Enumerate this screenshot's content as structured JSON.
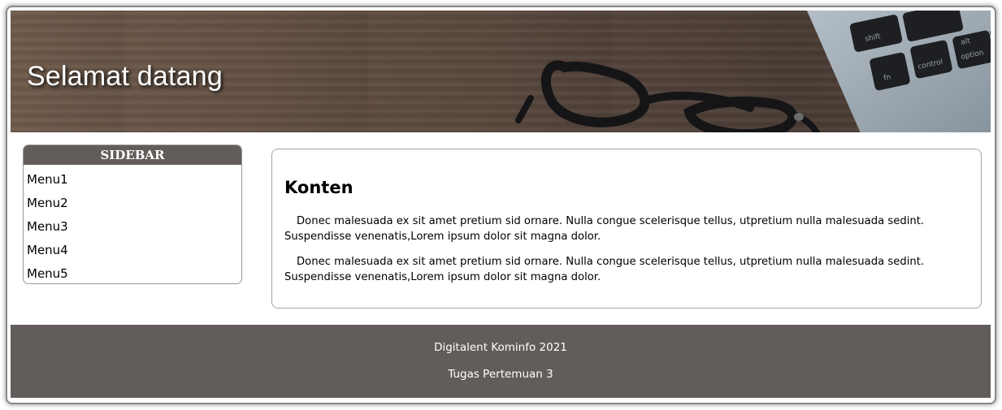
{
  "header": {
    "title": "Selamat datang"
  },
  "sidebar": {
    "title": "SIDEBAR",
    "items": [
      {
        "label": "Menu1"
      },
      {
        "label": "Menu2"
      },
      {
        "label": "Menu3"
      },
      {
        "label": "Menu4"
      },
      {
        "label": "Menu5"
      }
    ]
  },
  "content": {
    "heading": "Konten",
    "paragraphs": [
      "Donec malesuada ex sit amet pretium sid ornare. Nulla congue scelerisque tellus, utpretium nulla malesuada sedint. Suspendisse venenatis,Lorem ipsum dolor sit magna dolor.",
      "Donec malesuada ex sit amet pretium sid ornare. Nulla congue scelerisque tellus, utpretium nulla malesuada sedint. Suspendisse venenatis,Lorem ipsum dolor sit magna dolor."
    ]
  },
  "footer": {
    "line1": "Digitalent Kominfo 2021",
    "line2": "Tugas Pertemuan 3"
  },
  "colors": {
    "bar": "#625d5b",
    "header_wood": "#5f4c3f",
    "border": "#9a9a9a"
  },
  "header_decoration": {
    "keys": [
      "shift",
      "control",
      "option",
      "fn",
      "alt"
    ]
  }
}
